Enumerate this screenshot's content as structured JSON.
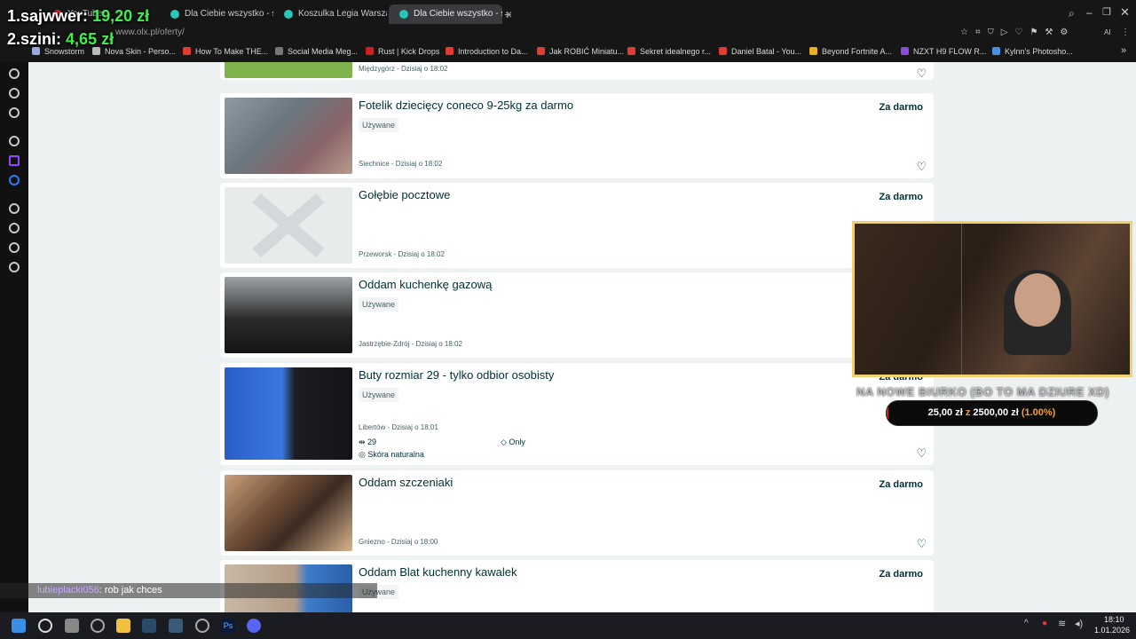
{
  "tabs": [
    {
      "label": "YouTube",
      "active": false
    },
    {
      "label": "Dla Ciebie wszystko - spr",
      "active": false
    },
    {
      "label": "Koszulka Legia Warszawa",
      "active": false
    },
    {
      "label": "Dla Ciebie wszystko - spr",
      "active": true
    }
  ],
  "address": {
    "url": "www.olx.pl/oferty/"
  },
  "bookmarks": [
    "Snowstorm",
    "Nova Skin - Perso...",
    "How To Make THE...",
    "Social Media Meg...",
    "Rust | Kick Drops",
    "Introduction to Da...",
    "Jak ROBIĆ Miniatu...",
    "Sekret idealnego r...",
    "Daniel Batal - You...",
    "Beyond Fortnite A...",
    "NZXT H9 FLOW R...",
    "Kylnn's Photosho..."
  ],
  "donors": [
    {
      "rank": "1.",
      "name": "sajwwer:",
      "amount": "19,20 zł"
    },
    {
      "rank": "2.",
      "name": "szini:",
      "amount": "4,65 zł"
    }
  ],
  "listings": [
    {
      "title": "",
      "condition": "",
      "location": "Międzygórz - Dzisiaj o 18:02",
      "price": ""
    },
    {
      "title": "Fotelik dziecięcy coneco 9-25kg za darmo",
      "condition": "Używane",
      "location": "Siechnice - Dzisiaj o 18:02",
      "price": "Za darmo"
    },
    {
      "title": "Gołębie pocztowe",
      "condition": "",
      "location": "Przeworsk - Dzisiaj o 18:02",
      "price": "Za darmo"
    },
    {
      "title": "Oddam kuchenkę gazową",
      "condition": "Używane",
      "location": "Jastrzębie-Zdrój - Dzisiaj o 18:02",
      "price": ""
    },
    {
      "title": "Buty rozmiar 29 - tylko odbior osobisty",
      "condition": "Używane",
      "location": "Libertów - Dzisiaj o 18:01",
      "price": "Za darmo",
      "params": {
        "size": "29",
        "type": "Only",
        "material": "Skóra naturalna"
      }
    },
    {
      "title": "Oddam szczeniaki",
      "condition": "",
      "location": "Gniezno - Dzisiaj o 18:00",
      "price": "Za darmo"
    },
    {
      "title": "Oddam Blat kuchenny kawalek",
      "condition": "Używane",
      "location": "",
      "price": "Za darmo"
    }
  ],
  "goal": {
    "text": "NA NOWE BIURKO (BO TO MA DZIURE XD)",
    "current": "25,00 zł",
    "sep": "z",
    "target": "2500,00 zł",
    "percent": "(1.00%)",
    "fraction": 0.01
  },
  "chat": {
    "user": "lubieplacki056",
    "message": ": rob jak chces"
  },
  "clock": {
    "time": "18:10",
    "date": "1.01.2026"
  },
  "colors": {
    "olx_text": "#002f34",
    "donor_amount": "#3df04a",
    "goal_fill": "#c8281e"
  }
}
